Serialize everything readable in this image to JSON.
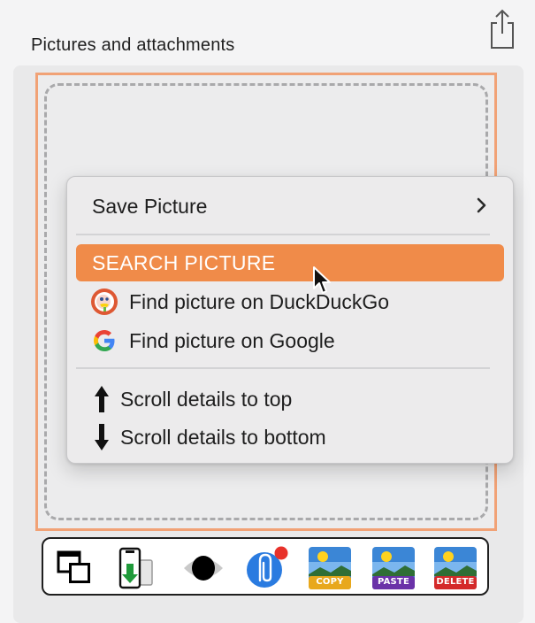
{
  "panel": {
    "title": "Pictures and attachments"
  },
  "context_menu": {
    "save_picture": "Save Picture",
    "search_picture": "SEARCH PICTURE",
    "find_duckduckgo": "Find picture on DuckDuckGo",
    "find_google": "Find picture on Google",
    "scroll_top": "Scroll details to top",
    "scroll_bottom": "Scroll details to bottom"
  },
  "toolbar": {
    "copy_label": "COPY",
    "paste_label": "PASTE",
    "delete_label": "DELETE"
  },
  "icons": {
    "share": "share-icon",
    "submenu": "chevron-right-icon",
    "duckduckgo": "duckduckgo-icon",
    "google": "google-icon",
    "arrow_up": "arrow-up-icon",
    "arrow_down": "arrow-down-icon",
    "cursor": "mouse-pointer-icon"
  },
  "colors": {
    "accent": "#f08b49",
    "frame_border": "#f1a276",
    "copy_band": "#e8a81c",
    "paste_band": "#6a32a8",
    "delete_band": "#d42a2a"
  }
}
